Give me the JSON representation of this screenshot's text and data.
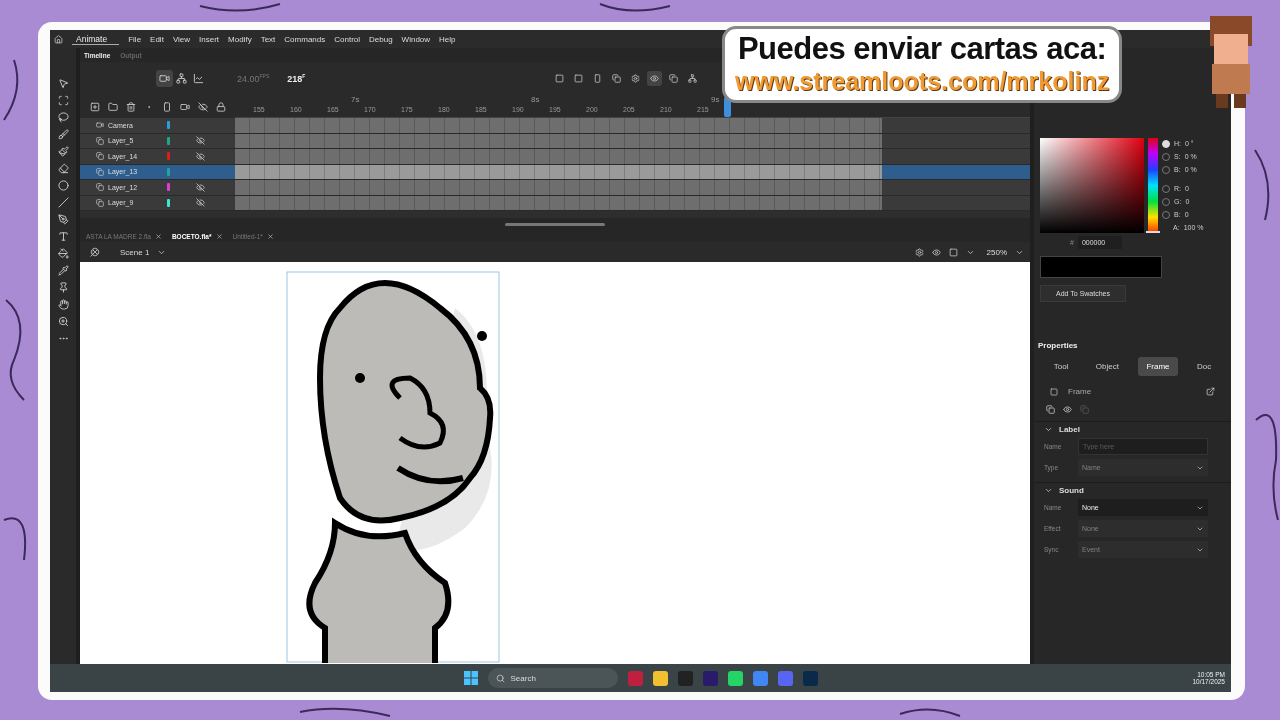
{
  "overlay": {
    "line1": "Puedes enviar cartas aca:",
    "line2": "www.streamloots.com/mrkolinz"
  },
  "menu": {
    "app": "Animate",
    "items": [
      "File",
      "Edit",
      "View",
      "Insert",
      "Modify",
      "Text",
      "Commands",
      "Control",
      "Debug",
      "Window",
      "Help"
    ]
  },
  "panel_tabs": [
    {
      "label": "Timeline",
      "selected": true
    },
    {
      "label": "Output",
      "selected": false
    }
  ],
  "timeline": {
    "fps": "24.00",
    "fps_unit": "FPS",
    "frame": "218",
    "frame_unit": "F",
    "seconds": [
      "7s",
      "8s",
      "9s"
    ],
    "ruler": [
      "155",
      "160",
      "165",
      "170",
      "175",
      "180",
      "185",
      "190",
      "195",
      "200",
      "205",
      "210",
      "215"
    ]
  },
  "layers": [
    {
      "name": "Camera",
      "kind": "camera",
      "color": "#2a9fe0",
      "hidden": false,
      "selected": false
    },
    {
      "name": "Layer_5",
      "kind": "layer",
      "color": "#1fa58a",
      "hidden": true,
      "selected": false
    },
    {
      "name": "Layer_14",
      "kind": "layer",
      "color": "#d91e1e",
      "hidden": true,
      "selected": false
    },
    {
      "name": "Layer_13",
      "kind": "layer",
      "color": "#1fa59a",
      "hidden": false,
      "selected": true
    },
    {
      "name": "Layer_12",
      "kind": "layer",
      "color": "#e03ad8",
      "hidden": true,
      "selected": false
    },
    {
      "name": "Layer_9",
      "kind": "layer",
      "color": "#38e8d8",
      "hidden": true,
      "selected": false
    }
  ],
  "doc_tabs": [
    {
      "label": "ASTA LA MADRE 2.fla",
      "selected": false
    },
    {
      "label": "BOCETO.fla*",
      "selected": true
    },
    {
      "label": "Untitled-1*",
      "selected": false
    }
  ],
  "scene": "Scene 1",
  "zoom": "250%",
  "color_picker": {
    "fields": [
      {
        "label": "H:",
        "value": "0 °",
        "selected": true
      },
      {
        "label": "S:",
        "value": "0 %",
        "selected": false
      },
      {
        "label": "B:",
        "value": "0 %",
        "selected": false
      },
      {
        "label": "R:",
        "value": "0",
        "selected": false
      },
      {
        "label": "G:",
        "value": "0",
        "selected": false
      },
      {
        "label": "B:",
        "value": "0",
        "selected": false
      }
    ],
    "alpha_label": "A:",
    "alpha": "100 %",
    "hash": "#",
    "hex": "000000",
    "hue": {
      "level": 0
    },
    "add_button": "Add To Swatches"
  },
  "properties": {
    "title": "Properties",
    "tabs": [
      {
        "label": "Tool",
        "selected": false
      },
      {
        "label": "Object",
        "selected": false
      },
      {
        "label": "Frame",
        "selected": true
      },
      {
        "label": "Doc",
        "selected": false
      }
    ],
    "header": "Frame",
    "sections": [
      {
        "title": "Label",
        "rows": [
          {
            "label": "Name",
            "kind": "input",
            "placeholder": "Type here",
            "disabled": false
          },
          {
            "label": "Type",
            "kind": "select",
            "value": "Name",
            "disabled": true
          }
        ]
      },
      {
        "title": "Sound",
        "rows": [
          {
            "label": "Name",
            "kind": "select",
            "value": "None",
            "disabled": false
          },
          {
            "label": "Effect",
            "kind": "select",
            "value": "None",
            "disabled": true
          },
          {
            "label": "Sync",
            "kind": "select",
            "value": "Event",
            "disabled": true
          }
        ]
      }
    ]
  },
  "taskbar": {
    "search": "Search",
    "time": "10:05 PM",
    "date": "10/17/2025"
  }
}
